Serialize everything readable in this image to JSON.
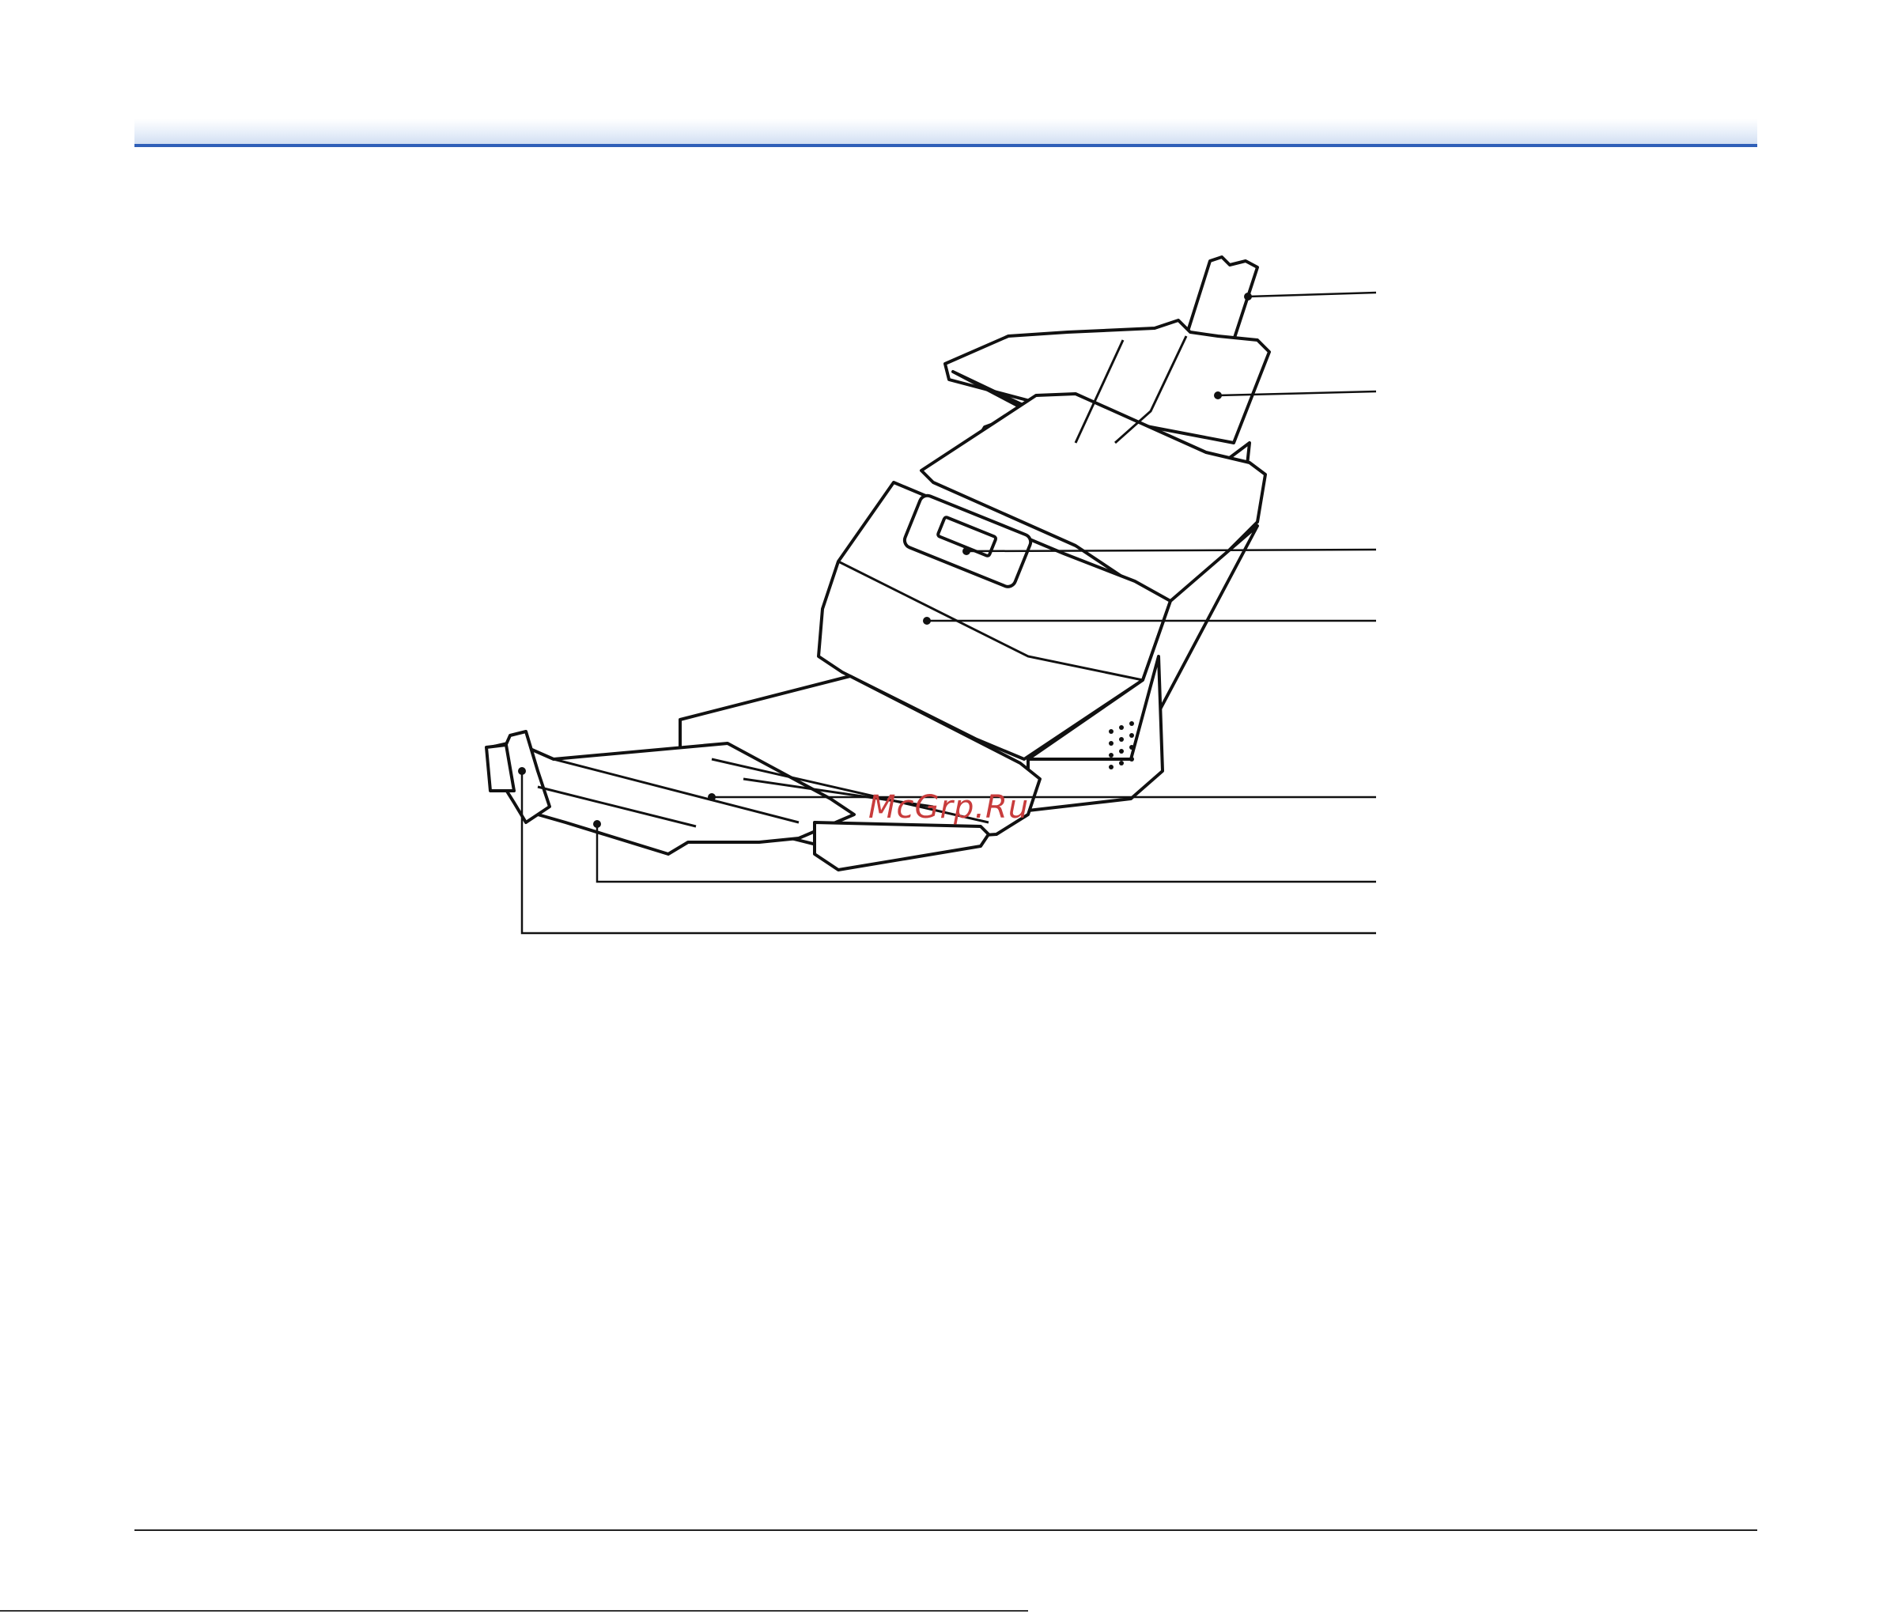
{
  "header": {
    "accent_color": "#2f5fb8"
  },
  "figure": {
    "subject": "document-scanner-icon",
    "callouts": 7
  },
  "watermark": {
    "text": "McGrp.Ru",
    "color": "#c83c3c"
  }
}
